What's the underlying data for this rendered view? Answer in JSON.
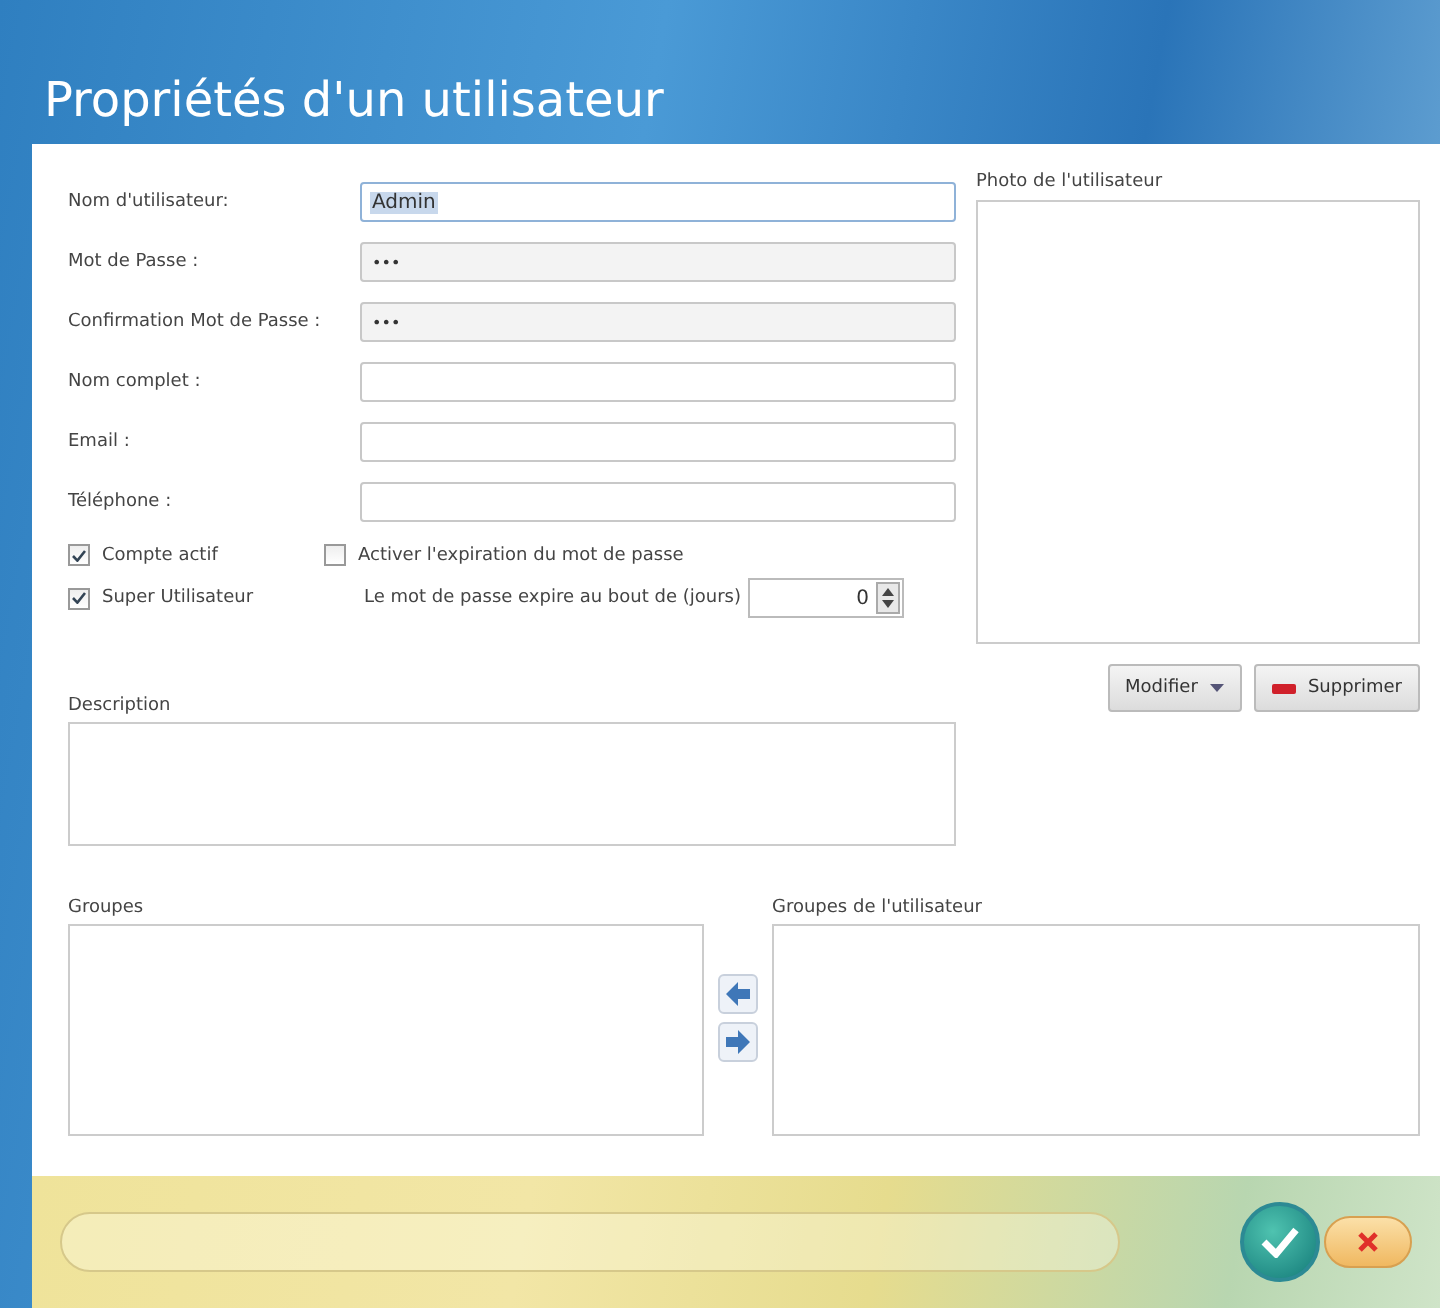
{
  "window": {
    "title": "Propriétés d'un utilisateur"
  },
  "fields": [
    {
      "label": "Nom d'utilisateur:",
      "value": "Admin",
      "kind": "text",
      "selected": true
    },
    {
      "label": "Mot de Passe :",
      "value": "•••",
      "kind": "password",
      "selected": false
    },
    {
      "label": "Confirmation Mot de Passe :",
      "value": "•••",
      "kind": "password",
      "selected": false
    },
    {
      "label": "Nom complet :",
      "kind": "text",
      "selected": false
    },
    {
      "label": "Email :",
      "kind": "text",
      "selected": false
    },
    {
      "label": "Téléphone :",
      "kind": "text",
      "selected": false
    }
  ],
  "account_options": [
    {
      "label": "Compte actif",
      "checked": true
    },
    {
      "label": "Super Utilisateur",
      "checked": true
    }
  ],
  "expiration": {
    "label": "Activer l'expiration du mot de passe",
    "checked": false
  },
  "expiry_days": {
    "label": "Le mot de passe expire au bout de (jours)",
    "value": "0"
  },
  "photo": {
    "label": "Photo de l'utilisateur",
    "buttons": [
      "Modifier",
      "Supprimer"
    ]
  },
  "description": {
    "label": "Description"
  },
  "groups": {
    "label": "Groupes"
  },
  "user_groups": {
    "label": "Groupes de l'utilisateur"
  }
}
